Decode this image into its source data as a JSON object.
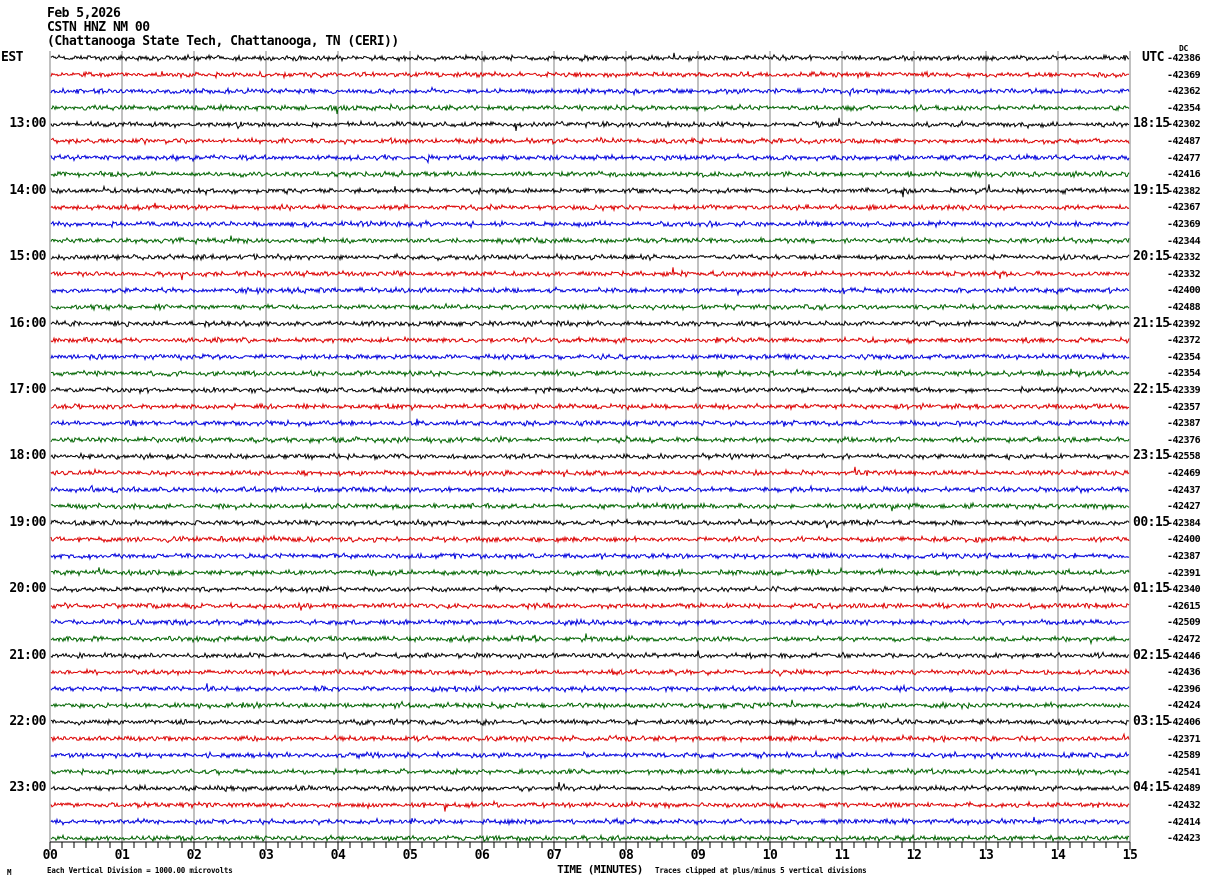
{
  "header": {
    "date": "Feb 5,2026",
    "station": "CSTN HNZ NM 00",
    "description": "(Chattanooga State Tech, Chattanooga, TN (CERI))"
  },
  "axes": {
    "left_tz": "EST",
    "right_tz": "UTC",
    "dc_header": "DC",
    "xlabel": "TIME (MINUTES)"
  },
  "footer": {
    "symbol": "M",
    "scale_note": "Each Vertical Division = 1000.00 microvolts",
    "clip_note": "Traces clipped at plus/minus 5 vertical divisions"
  },
  "colors": {
    "black": "#000000",
    "red": "#dc0000",
    "blue": "#0000dc",
    "green": "#006400",
    "grid": "#808080"
  },
  "chart_data": {
    "type": "line",
    "subtype": "helicorder_seismogram",
    "title": "CSTN HNZ NM 00 (Chattanooga State Tech, Chattanooga, TN (CERI)) Feb 5,2026",
    "xlabel": "TIME (MINUTES)",
    "x_ticks": [
      "00",
      "01",
      "02",
      "03",
      "04",
      "05",
      "06",
      "07",
      "08",
      "09",
      "10",
      "11",
      "12",
      "13",
      "14",
      "15"
    ],
    "x_range_minutes": [
      0,
      15
    ],
    "rows_total": 48,
    "row_duration_minutes": 15,
    "row_color_cycle": [
      "black",
      "red",
      "blue",
      "green"
    ],
    "hour_marks": [
      {
        "row": 4,
        "est": "13:00",
        "utc": "18:15"
      },
      {
        "row": 8,
        "est": "14:00",
        "utc": "19:15"
      },
      {
        "row": 12,
        "est": "15:00",
        "utc": "20:15"
      },
      {
        "row": 16,
        "est": "16:00",
        "utc": "21:15"
      },
      {
        "row": 20,
        "est": "17:00",
        "utc": "22:15"
      },
      {
        "row": 24,
        "est": "18:00",
        "utc": "23:15"
      },
      {
        "row": 28,
        "est": "19:00",
        "utc": "00:15"
      },
      {
        "row": 32,
        "est": "20:00",
        "utc": "01:15"
      },
      {
        "row": 36,
        "est": "21:00",
        "utc": "02:15"
      },
      {
        "row": 40,
        "est": "22:00",
        "utc": "03:15"
      },
      {
        "row": 44,
        "est": "23:00",
        "utc": "04:15"
      }
    ],
    "dc_offsets": [
      -42386,
      -42369,
      -42362,
      -42354,
      -42302,
      -42487,
      -42477,
      -42416,
      -42382,
      -42367,
      -42369,
      -42344,
      -42332,
      -42332,
      -42400,
      -42488,
      -42392,
      -42372,
      -42354,
      -42354,
      -42339,
      -42357,
      -42387,
      -42376,
      -42558,
      -42469,
      -42437,
      -42427,
      -42384,
      -42400,
      -42387,
      -42391,
      -42340,
      -42615,
      -42509,
      -42472,
      -42446,
      -42436,
      -42396,
      -42424,
      -42406,
      -42371,
      -42589,
      -42541,
      -42489,
      -42432,
      -42414,
      -42423
    ],
    "scale_note": "Each Vertical Division = 1000.00 microvolts",
    "clip_note": "Traces clipped at plus/minus 5 vertical divisions"
  }
}
